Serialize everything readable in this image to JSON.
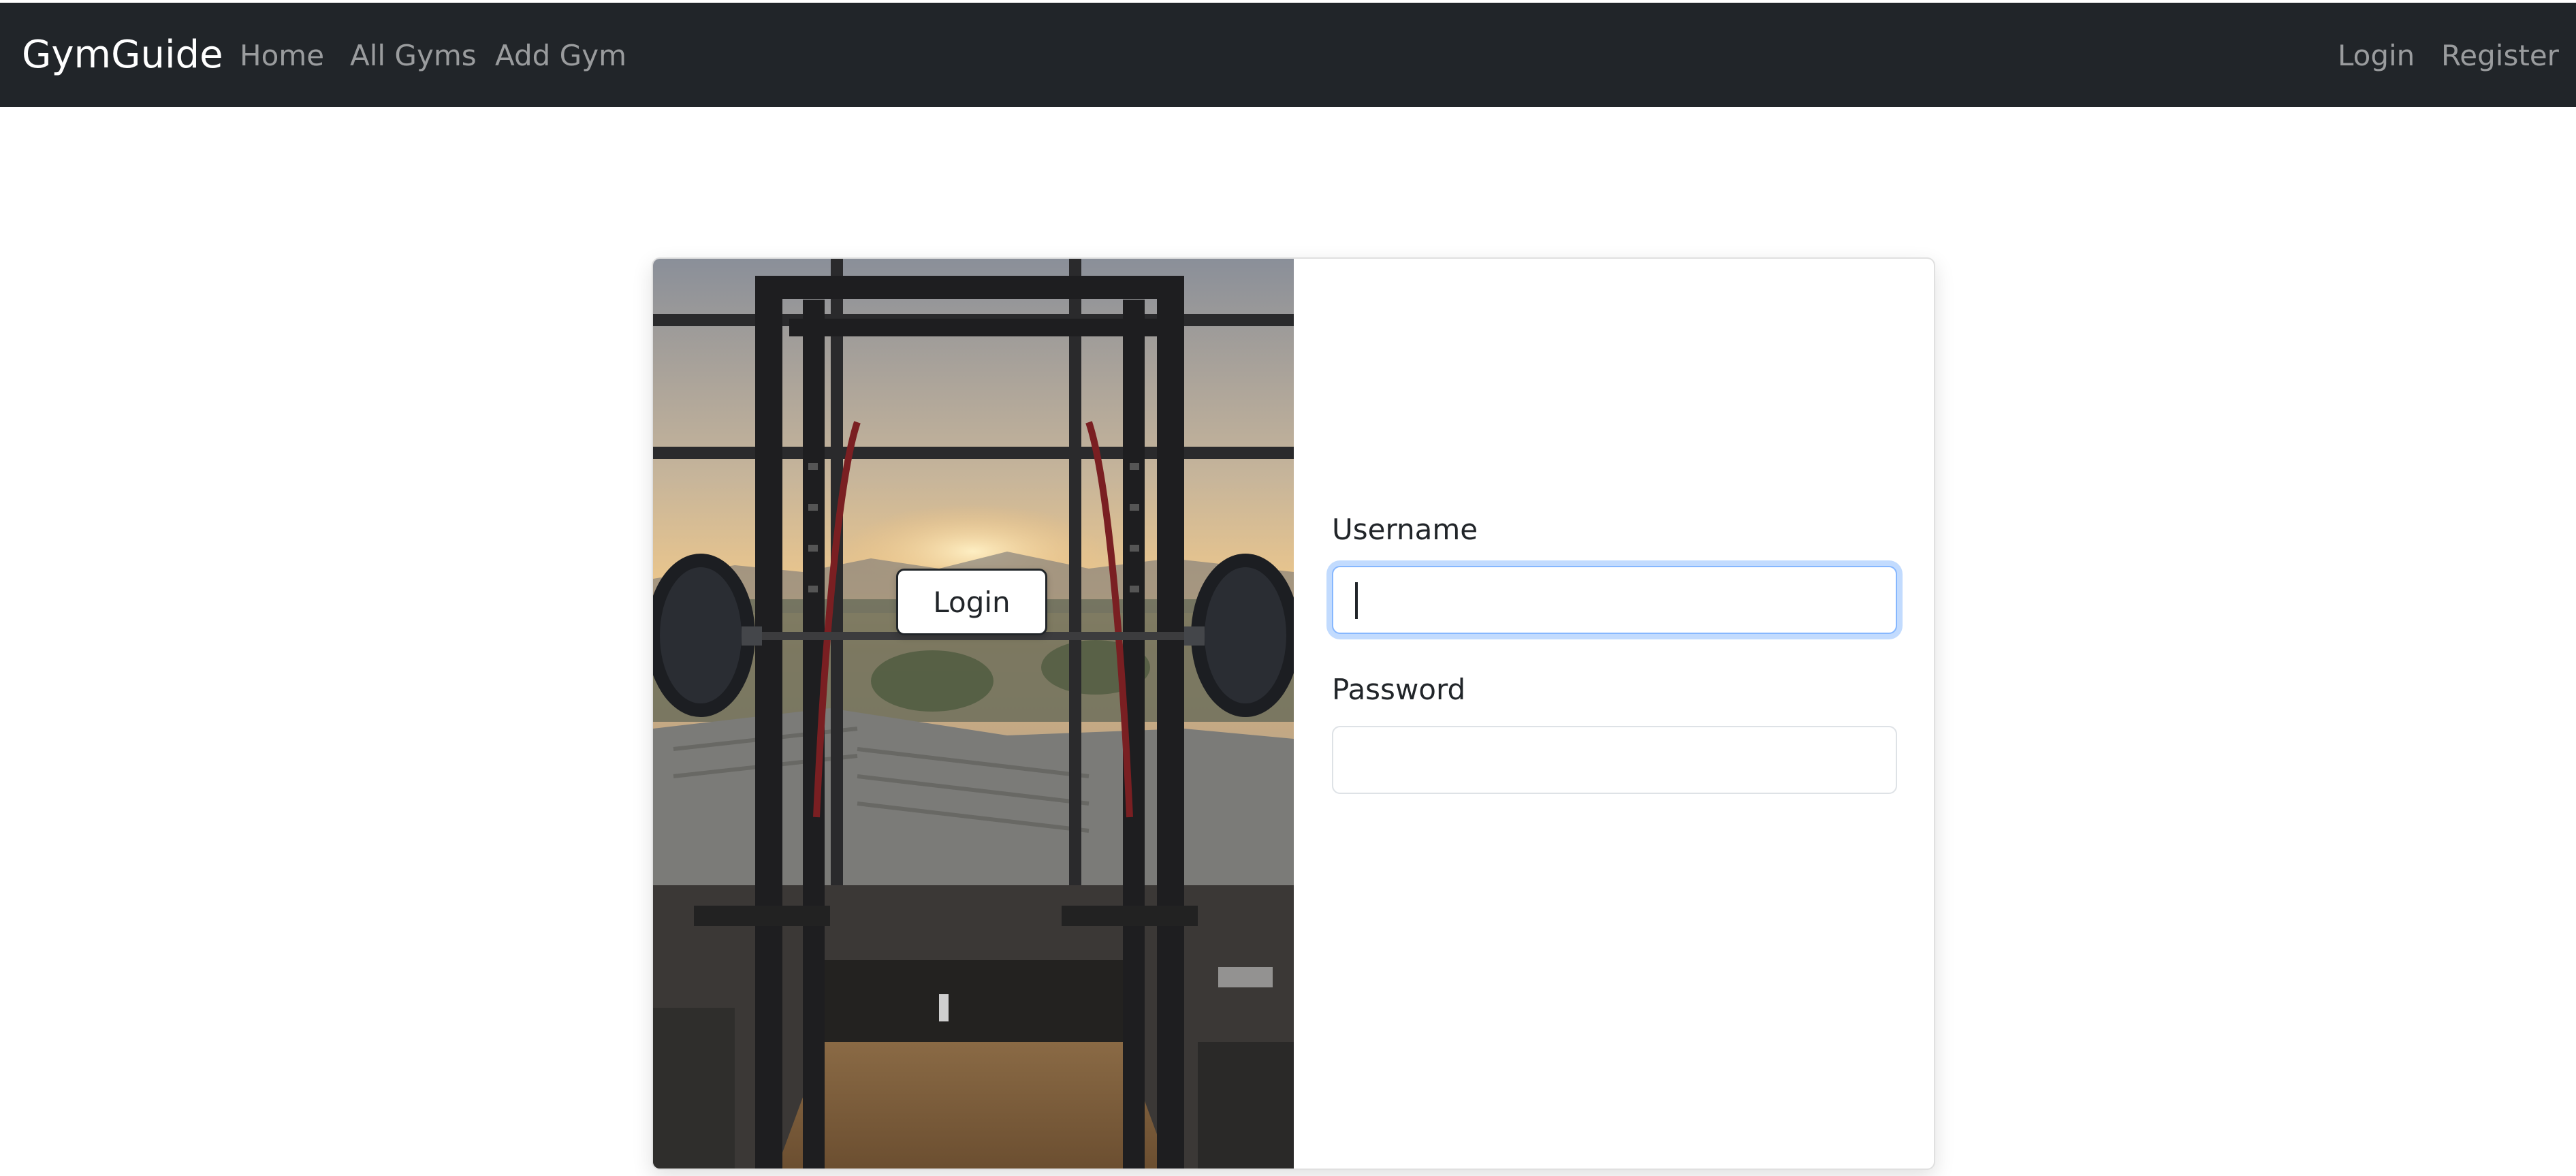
{
  "navbar": {
    "brand": "GymGuide",
    "links": {
      "home": "Home",
      "all_gyms": "All Gyms",
      "add_gym": "Add Gym"
    },
    "auth": {
      "login": "Login",
      "register": "Register"
    }
  },
  "login_form": {
    "username_label": "Username",
    "username_value": "",
    "password_label": "Password",
    "password_value": "",
    "submit_label": "Login"
  },
  "colors": {
    "navbar_bg": "#212529",
    "focus_ring": "#86b7fe",
    "nav_link": "rgba(255,255,255,0.55)"
  },
  "image": {
    "semantic": "gym-power-rack-photo"
  }
}
